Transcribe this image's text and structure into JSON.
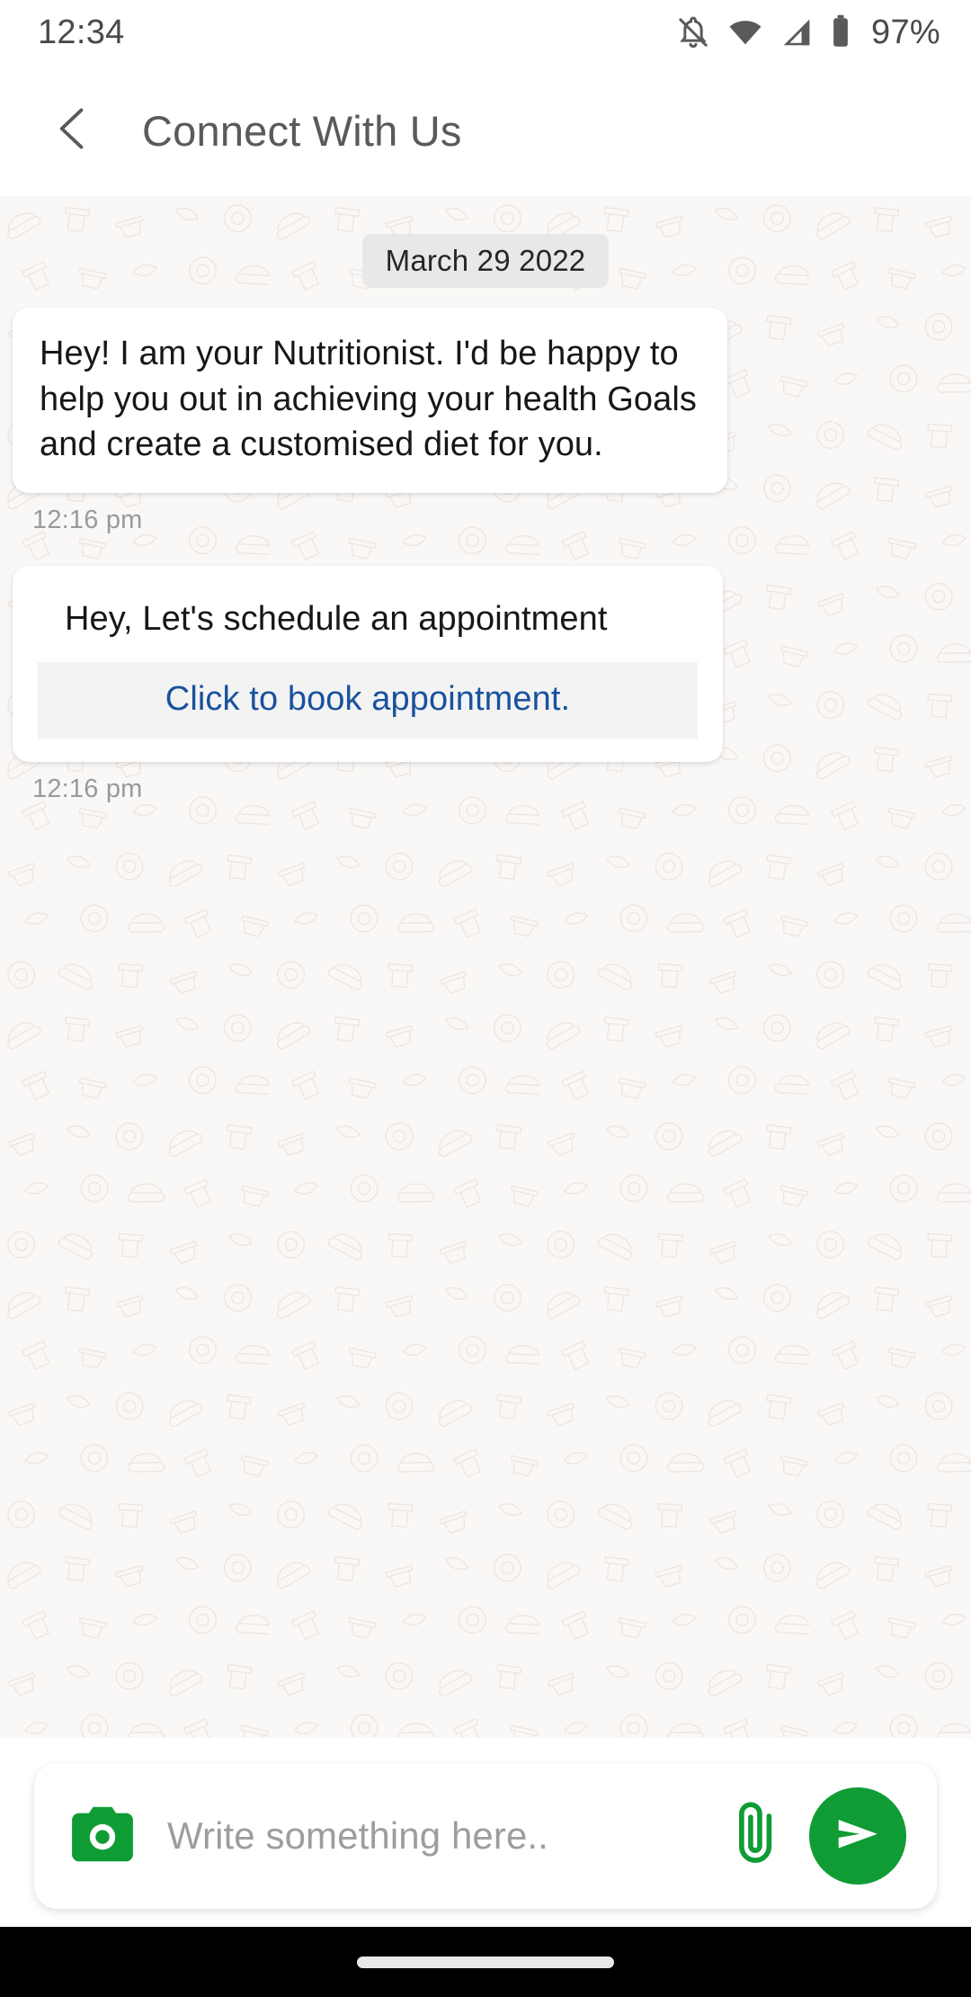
{
  "status_bar": {
    "time": "12:34",
    "battery_percent": "97%",
    "icons": [
      "bell-off-icon",
      "wifi-icon",
      "cellular-signal-icon",
      "battery-icon"
    ]
  },
  "app_bar": {
    "back_icon": "chevron-left-icon",
    "title": "Connect With Us"
  },
  "chat": {
    "date_separator": "March 29 2022",
    "messages": [
      {
        "type": "text",
        "text": "Hey! I am your Nutritionist. I'd be happy to help you out in achieving your health Goals and create a customised diet for you.",
        "time": "12:16 pm"
      },
      {
        "type": "card",
        "title": "Hey, Let's schedule an appointment",
        "action_label": "Click to book appointment.",
        "time": "12:16 pm"
      }
    ]
  },
  "composer": {
    "camera_icon": "camera-icon",
    "placeholder": "Write something here..",
    "value": "",
    "attach_icon": "paperclip-icon",
    "send_icon": "send-icon"
  },
  "nav_bar": {
    "handle": "gesture-pill"
  },
  "colors": {
    "brand_green": "#109C35",
    "link_blue": "#19529E",
    "chat_background": "#FAF8F6",
    "bubble_white": "#FFFFFF",
    "date_chip_bg": "#E8E8E8",
    "action_bg": "#F3F3F3",
    "timestamp_gray": "#9A9A9A",
    "title_gray": "#5A5A5A",
    "nav_black": "#000000"
  }
}
